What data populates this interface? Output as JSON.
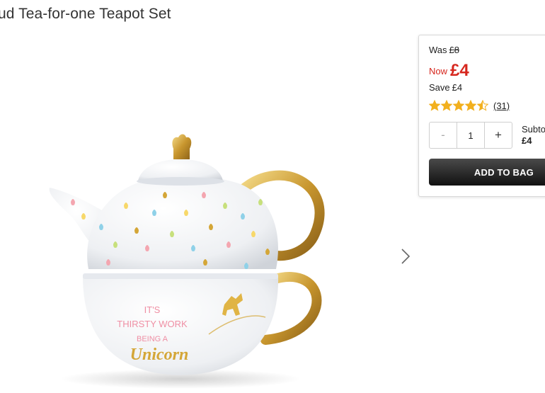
{
  "product": {
    "title": "ud Tea-for-one Teapot Set",
    "image_alt": "Teapot with gold handle, rainbow drops and text IT'S THIRSTY WORK BEING A Unicorn"
  },
  "mug_text": {
    "line1": "IT'S",
    "line2": "THIRSTY WORK",
    "line3": "BEING A",
    "line4": "Unicorn"
  },
  "pricing": {
    "was_label": "Was",
    "was_value": "£8",
    "now_label": "Now",
    "now_value": "£4",
    "save_label": "Save",
    "save_value": "£4",
    "rating": 4.5,
    "review_count": "(31)"
  },
  "quantity": {
    "minus": "-",
    "value": "1",
    "plus": "+"
  },
  "subtotal": {
    "label": "Subto",
    "value": "£4"
  },
  "actions": {
    "add_to_bag": "ADD TO BAG"
  },
  "colors": {
    "price_red": "#d6261d",
    "star": "#f2b01e",
    "gold": "#d4a637",
    "button_dark": "#222222"
  },
  "icons": {
    "next": "chevron-right-icon",
    "star": "star-icon"
  }
}
